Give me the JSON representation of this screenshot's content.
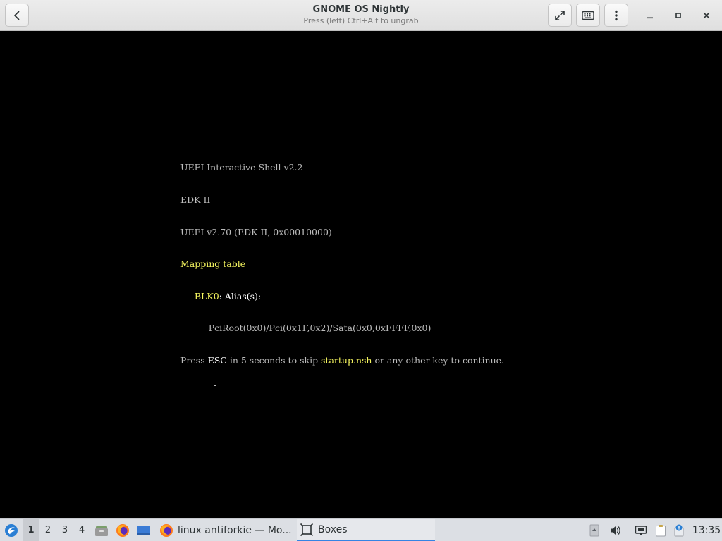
{
  "window": {
    "title": "GNOME OS Nightly",
    "subtitle": "Press (left) Ctrl+Alt to ungrab"
  },
  "header_buttons": {
    "back": "back-arrow-icon",
    "fullscreen": "fullscreen-icon",
    "keyboard": "keyboard-icon",
    "menu": "kebab-menu-icon",
    "minimize": "minimize-icon",
    "maximize": "maximize-icon",
    "close": "close-icon"
  },
  "console": {
    "line1": "UEFI Interactive Shell v2.2",
    "line2": "EDK II",
    "line3": "UEFI v2.70 (EDK II, 0x00010000)",
    "line4": "Mapping table",
    "line5_indent": "     ",
    "line5_device": "BLK0",
    "line5_rest": ": Alias(s):",
    "line6": "          PciRoot(0x0)/Pci(0x1F,0x2)/Sata(0x0,0xFFFF,0x0)",
    "line7_a": "Press ",
    "line7_esc": "ESC",
    "line7_b": " in 5 seconds to skip ",
    "line7_file": "startup.nsh",
    "line7_c": " or any other key to continue."
  },
  "taskbar": {
    "workspaces": [
      "1",
      "2",
      "3",
      "4"
    ],
    "active_workspace": "1",
    "tasks": [
      {
        "label": "linux antiforkie — Mo...",
        "icon": "firefox-icon"
      },
      {
        "label": "Boxes",
        "icon": "boxes-icon"
      }
    ],
    "clock": "13:35"
  },
  "colors": {
    "console_text": "#bdbdbd",
    "console_highlight": "#f5f55f",
    "accent": "#3584e4"
  }
}
